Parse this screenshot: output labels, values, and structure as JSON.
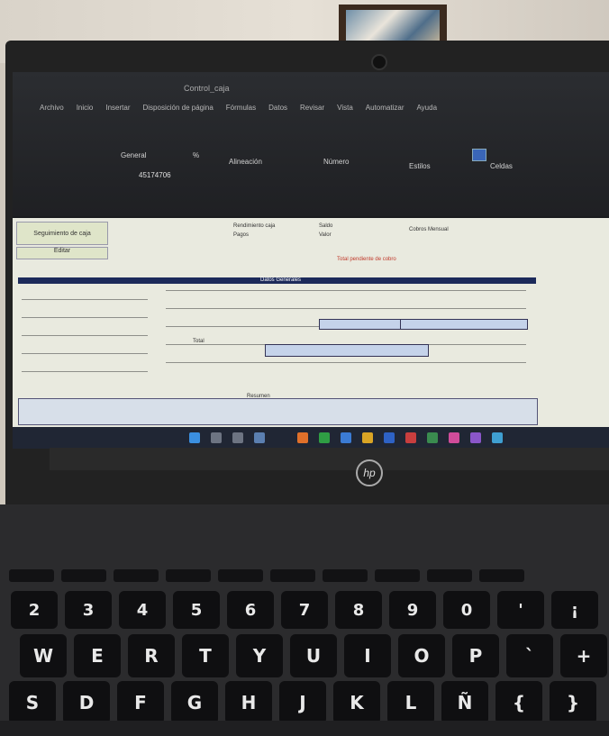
{
  "excel": {
    "title": "Control_caja",
    "menu": [
      "Archivo",
      "Inicio",
      "Insertar",
      "Disposición de página",
      "Fórmulas",
      "Datos",
      "Revisar",
      "Vista",
      "Automatizar",
      "Ayuda"
    ],
    "cell_reference": "45174706",
    "toolbar_labels": [
      "General",
      "%",
      "Alineación",
      "Número",
      "Estilos",
      "Celdas"
    ],
    "sheet_button_left": "Seguimiento de caja",
    "sheet_button_left2": "Editar",
    "section_header": "Datos Generales",
    "red_note": "Total pendiente de cobro",
    "sheet_hints": [
      "Rendimiento caja",
      "Pagos",
      "Saldo",
      "Valor",
      "Cobros Mensual",
      "Total",
      "Resumen"
    ]
  },
  "keyboard": {
    "number_row": [
      "2",
      "3",
      "4",
      "5",
      "6",
      "7",
      "8",
      "9",
      "0",
      "'",
      "¡"
    ],
    "top_row": [
      "W",
      "E",
      "R",
      "T",
      "Y",
      "U",
      "I",
      "O",
      "P",
      "`",
      "+"
    ],
    "home_row": [
      "S",
      "D",
      "F",
      "G",
      "H",
      "J",
      "K",
      "L",
      "Ñ",
      "{",
      "}"
    ]
  },
  "brand_logo": "hp",
  "colors": {
    "sheet_header": "#1c2a5a",
    "taskbar": "#202634",
    "keycap": "#0f0f11"
  }
}
